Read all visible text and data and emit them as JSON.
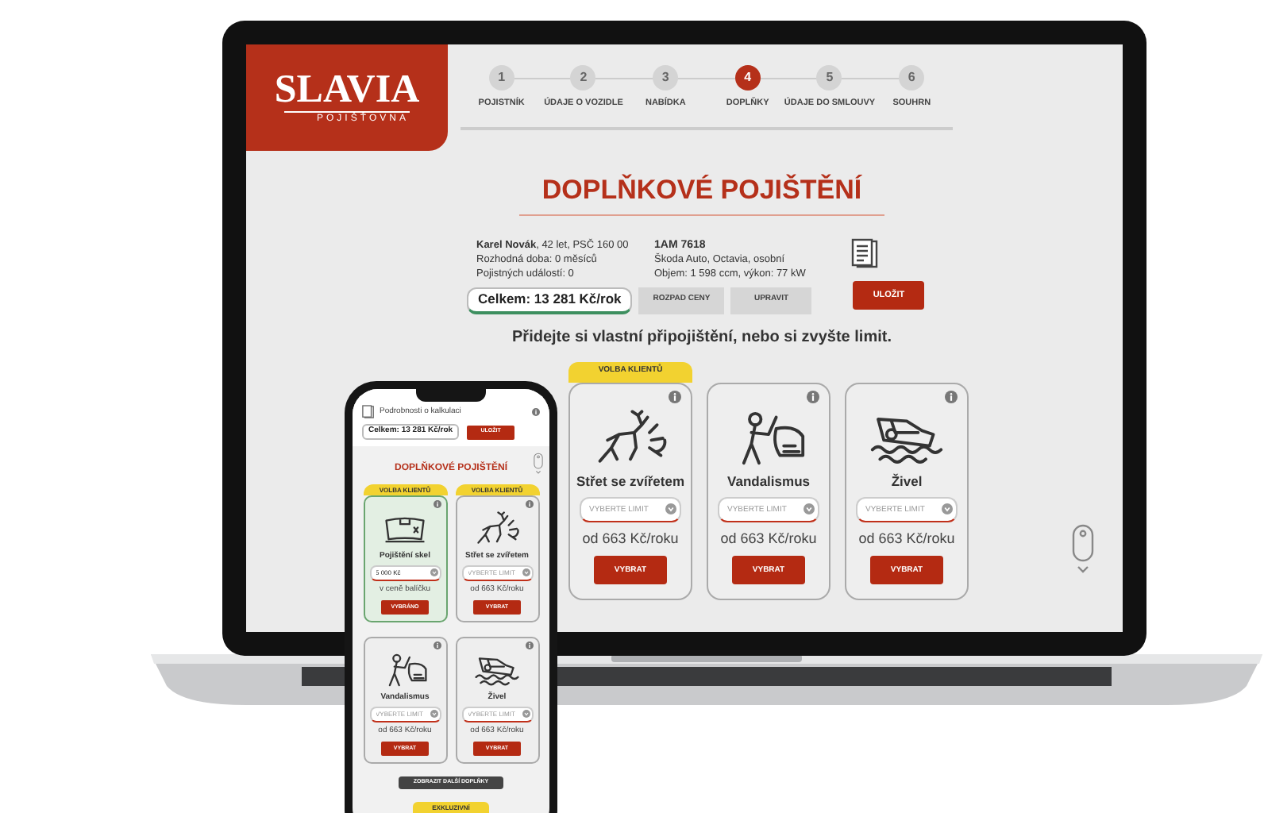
{
  "laptop": {
    "logo": {
      "name": "SLAVIA",
      "sub": "POJIŠŤOVNA"
    },
    "steps": [
      {
        "number": "1",
        "label": "POJISTNÍK",
        "selected": false
      },
      {
        "number": "2",
        "label": "ÚDAJE O VOZIDLE",
        "selected": false
      },
      {
        "number": "3",
        "label": "NABÍDKA",
        "selected": false
      },
      {
        "number": "4",
        "label": "DOPLŇKY",
        "selected": true
      },
      {
        "number": "5",
        "label": "ÚDAJE DO SMLOUVY",
        "selected": false
      },
      {
        "number": "6",
        "label": "SOUHRN",
        "selected": false
      }
    ],
    "title": "DOPLŇKOVÉ POJIŠTĚNÍ",
    "client": [
      "**Karel Novák**, 42 let, PSČ 160 00",
      "Rozhodná doba:  0 měsíců",
      "Pojistných událostí: 0"
    ],
    "vehicle": {
      "plate": "1AM 7618",
      "lines": [
        "Škoda Auto, Octavia, osobní",
        "Objem: 1 598 ccm, výkon: 77 kW"
      ]
    },
    "total": "Celkem: 13 281 Kč/rok",
    "breakdown_button": "ROZPAD CENY",
    "edit_button": "UPRAVIT",
    "save_button": "ULOŽIT",
    "prompt": "Přidejte si vlastní připojištění, nebo si zvyšte limit.",
    "cards": [
      {
        "badge": "VOLBA KLIENTŮ",
        "kind": "deer",
        "title": "Střet se zvířetem",
        "limit": {
          "placeholder": "VYBERTE LIMIT"
        },
        "price": "od 663 Kč/roku",
        "button": "VYBRAT",
        "selected": false
      },
      {
        "kind": "vandal",
        "title": "Vandalismus",
        "limit": {
          "placeholder": "VYBERTE LIMIT"
        },
        "price": "od 663 Kč/roku",
        "button": "VYBRAT",
        "selected": false
      },
      {
        "kind": "flood",
        "title": "Živel",
        "limit": {
          "placeholder": "VYBERTE LIMIT"
        },
        "price": "od 663 Kč/roku",
        "button": "VYBRAT",
        "selected": false
      }
    ]
  },
  "phone": {
    "header": "Podrobnosti o kalkulaci",
    "total": "Celkem: 13 281 Kč/rok",
    "save_button": "ULOŽIT",
    "title": "DOPLŇKOVÉ POJIŠTĚNÍ",
    "cards": [
      {
        "badge": "VOLBA KLIENTŮ",
        "kind": "glass",
        "title": "Pojištění skel",
        "limit": {
          "value": "5 000 Kč"
        },
        "price": "v ceně balíčku",
        "button": "VYBRÁNO",
        "selected": true
      },
      {
        "badge": "VOLBA KLIENTŮ",
        "kind": "deer",
        "title": "Střet se zvířetem",
        "limit": {
          "placeholder": "VYBERTE LIMIT"
        },
        "price": "od 663 Kč/roku",
        "button": "VYBRAT",
        "selected": false
      },
      {
        "kind": "vandal",
        "title": "Vandalismus",
        "limit": {
          "placeholder": "VYBERTE LIMIT"
        },
        "price": "od 663 Kč/roku",
        "button": "VYBRAT",
        "selected": false
      },
      {
        "kind": "flood",
        "title": "Živel",
        "limit": {
          "placeholder": "VYBERTE LIMIT"
        },
        "price": "od 663 Kč/roku",
        "button": "VYBRAT",
        "selected": false
      }
    ],
    "more_button": "ZOBRAZIT DALŠÍ DOPLŇKY",
    "bottom_badge": "EXKLUZIVNÍ"
  }
}
